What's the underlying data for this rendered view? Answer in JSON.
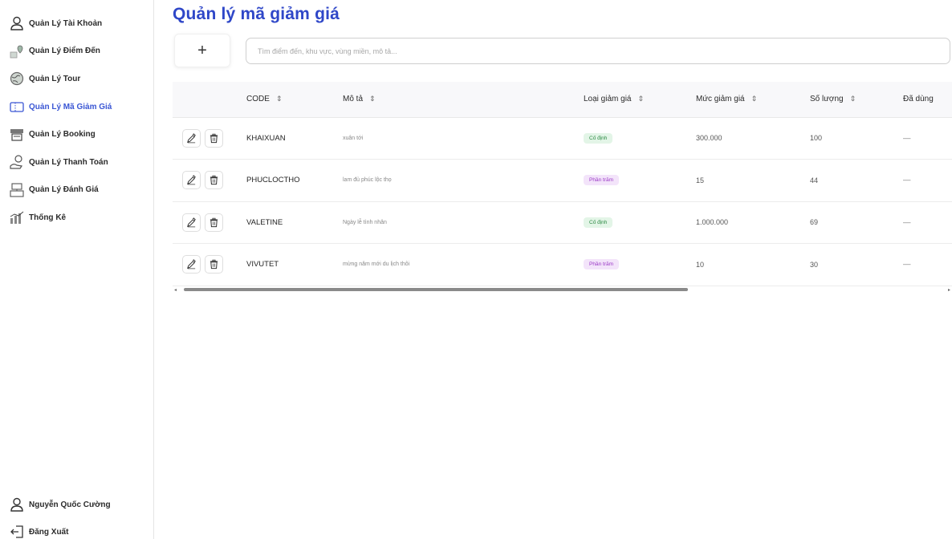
{
  "sidebar": {
    "items": [
      {
        "label": "Quản Lý Tài Khoản",
        "icon": "user-icon"
      },
      {
        "label": "Quản Lý Điểm Đến",
        "icon": "location-icon"
      },
      {
        "label": "Quản Lý Tour",
        "icon": "globe-icon"
      },
      {
        "label": "Quản Lý Mã Giảm Giá",
        "icon": "ticket-icon"
      },
      {
        "label": "Quản Lý Booking",
        "icon": "booking-icon"
      },
      {
        "label": "Quản Lý Thanh Toán",
        "icon": "payment-icon"
      },
      {
        "label": "Quản Lý Đánh Giá",
        "icon": "review-icon"
      },
      {
        "label": "Thống Kê",
        "icon": "chart-icon"
      }
    ],
    "active_index": 3,
    "user_name": "Nguyễn Quốc Cường",
    "logout_label": "Đăng Xuất"
  },
  "page": {
    "title": "Quản lý mã giảm giá",
    "add_label": "+",
    "search_placeholder": "Tìm điểm đến, khu vực, vùng miền, mô tả..."
  },
  "table": {
    "columns": [
      "CODE",
      "Mô tả",
      "Loại giảm giá",
      "Mức giảm giá",
      "Số lượng",
      "Đã dùng"
    ],
    "rows": [
      {
        "code": "KHAIXUAN",
        "desc": "xuân tới",
        "type": "Cố định",
        "type_kind": "fixed",
        "amount": "300.000",
        "qty": "100",
        "used": "—"
      },
      {
        "code": "PHUCLOCTHO",
        "desc": "lam đủ phúc lộc thọ",
        "type": "Phần trăm",
        "type_kind": "pct",
        "amount": "15",
        "qty": "44",
        "used": "—"
      },
      {
        "code": "VALETINE",
        "desc": "Ngày lễ tình nhân",
        "type": "Cố định",
        "type_kind": "fixed",
        "amount": "1.000.000",
        "qty": "69",
        "used": "—"
      },
      {
        "code": "VIVUTET",
        "desc": "mừng năm mới du lịch thôi",
        "type": "Phần trăm",
        "type_kind": "pct",
        "amount": "10",
        "qty": "30",
        "used": "—"
      }
    ]
  },
  "colors": {
    "accent": "#2f47c8",
    "badge_fixed_bg": "#e3f5e7",
    "badge_fixed_text": "#2d8a44",
    "badge_pct_bg": "#f3e4fa",
    "badge_pct_text": "#9a38c6"
  }
}
